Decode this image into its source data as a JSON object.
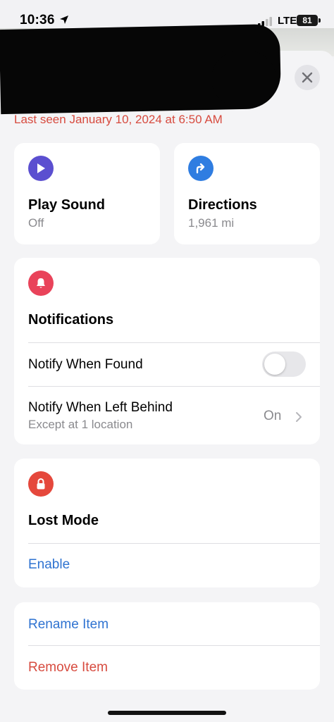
{
  "status_bar": {
    "time": "10:36",
    "network": "LTE",
    "battery": "81"
  },
  "header": {
    "last_seen": "Last seen January 10, 2024 at 6:50 AM"
  },
  "actions": {
    "play_sound": {
      "title": "Play Sound",
      "subtitle": "Off"
    },
    "directions": {
      "title": "Directions",
      "subtitle": "1,961 mi"
    }
  },
  "notifications": {
    "title": "Notifications",
    "notify_when_found": {
      "label": "Notify When Found",
      "enabled": false
    },
    "notify_when_left_behind": {
      "label": "Notify When Left Behind",
      "sublabel": "Except at 1 location",
      "value": "On"
    }
  },
  "lost_mode": {
    "title": "Lost Mode",
    "action": "Enable"
  },
  "item_actions": {
    "rename": "Rename Item",
    "remove": "Remove Item"
  },
  "colors": {
    "accent_blue": "#2f73d1",
    "destructive_red": "#d74b3f",
    "play_purple": "#5b4fd0",
    "directions_blue": "#2f7de1",
    "alert_red": "#e9435a"
  }
}
